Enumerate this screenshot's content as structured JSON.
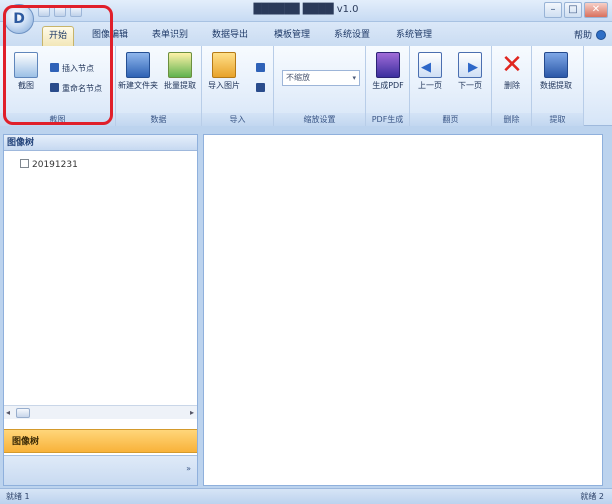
{
  "window": {
    "title": "██████ ████ v1.0",
    "minimize_glyph": "–",
    "maximize_glyph": "□",
    "close_glyph": "✕"
  },
  "app_orb": {
    "glyph": "D"
  },
  "tabs": [
    {
      "label": "开始"
    },
    {
      "label": "图像编辑"
    },
    {
      "label": "表单识别"
    },
    {
      "label": "数据导出"
    },
    {
      "label": "模板管理"
    },
    {
      "label": "系统设置"
    },
    {
      "label": "系统管理"
    }
  ],
  "help": {
    "label": "帮助"
  },
  "ribbon": {
    "screenshot_button": "截图",
    "insert_node": "插入节点",
    "rename_node": "重命名节点",
    "new_folder_button": "新建文件夹",
    "batch_extract_button": "批量提取",
    "import_image_button": "导入图片",
    "dropdown_value": "不缩放",
    "dropdown_caret": "▾",
    "pdf_button": "生成PDF",
    "prev_button": "上一页",
    "prev_arrow": "◀",
    "next_button": "下一页",
    "next_arrow": "▶",
    "delete_button": "删除",
    "delete_glyph": "✕",
    "data_extract_button": "数据提取",
    "groups": {
      "screenshot": "截图",
      "data": "数据",
      "import": "导入",
      "scale": "缩放设置",
      "pdf": "PDF生成",
      "page": "翻页",
      "delete": "删除",
      "extract": "提取"
    }
  },
  "left_panel": {
    "header": "图像树",
    "tree_item": "20191231",
    "nav_button": "图像树",
    "scroll_left": "◂",
    "scroll_right": "▸",
    "footer_more": "»"
  },
  "status": {
    "left": "就绪 1",
    "right": "就绪 2"
  }
}
